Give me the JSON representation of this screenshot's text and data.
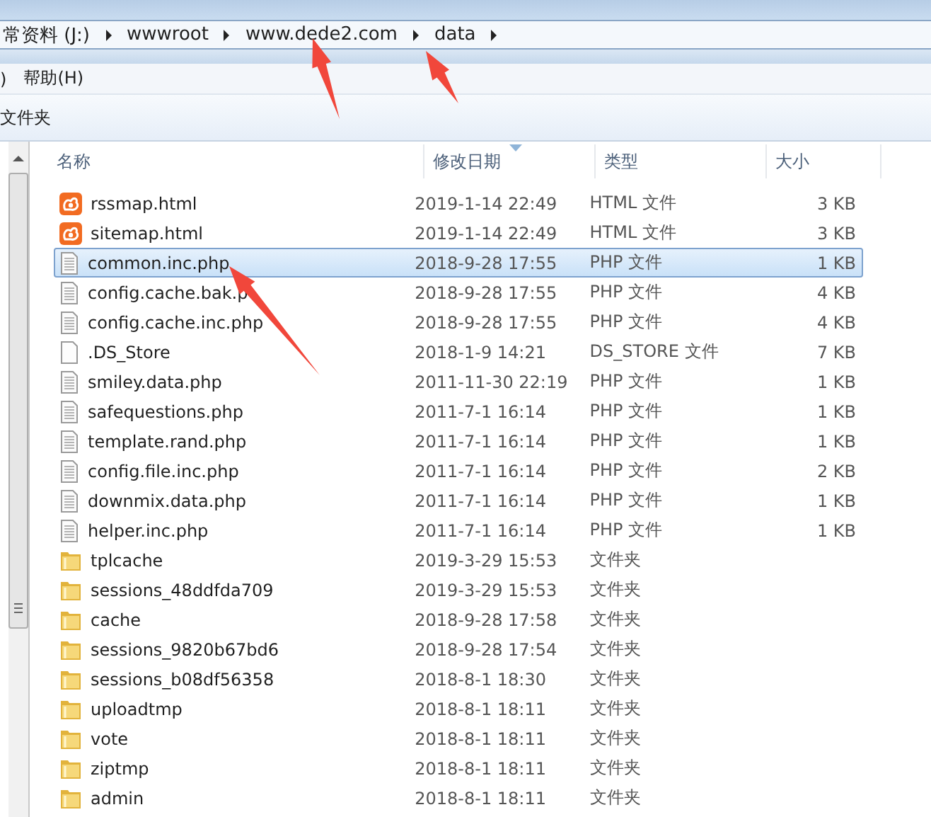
{
  "address_bar": {
    "crumbs": [
      "常资料 (J:)",
      "wwwroot",
      "www.dede2.com",
      "data"
    ]
  },
  "menu_bar": {
    "items": [
      ")",
      "帮助(H)"
    ]
  },
  "toolbar": {
    "items": [
      "文件夹"
    ]
  },
  "file_list": {
    "columns": [
      {
        "label": "名称",
        "sorted": false
      },
      {
        "label": "修改日期",
        "sorted": true
      },
      {
        "label": "类型",
        "sorted": false
      },
      {
        "label": "大小",
        "sorted": false
      }
    ],
    "rows": [
      {
        "name": "rssmap.html",
        "date": "2019-1-14 22:49",
        "type": "HTML 文件",
        "size": "3 KB",
        "kind": "html",
        "selected": false
      },
      {
        "name": "sitemap.html",
        "date": "2019-1-14 22:49",
        "type": "HTML 文件",
        "size": "3 KB",
        "kind": "html",
        "selected": false
      },
      {
        "name": "common.inc.php",
        "date": "2018-9-28 17:55",
        "type": "PHP 文件",
        "size": "1 KB",
        "kind": "text",
        "selected": true
      },
      {
        "name": "config.cache.bak.p",
        "date": "2018-9-28 17:55",
        "type": "PHP 文件",
        "size": "4 KB",
        "kind": "text",
        "selected": false
      },
      {
        "name": "config.cache.inc.php",
        "date": "2018-9-28 17:55",
        "type": "PHP 文件",
        "size": "4 KB",
        "kind": "text",
        "selected": false
      },
      {
        "name": ".DS_Store",
        "date": "2018-1-9 14:21",
        "type": "DS_STORE 文件",
        "size": "7 KB",
        "kind": "blank",
        "selected": false
      },
      {
        "name": "smiley.data.php",
        "date": "2011-11-30 22:19",
        "type": "PHP 文件",
        "size": "1 KB",
        "kind": "text",
        "selected": false
      },
      {
        "name": "safequestions.php",
        "date": "2011-7-1 16:14",
        "type": "PHP 文件",
        "size": "1 KB",
        "kind": "text",
        "selected": false
      },
      {
        "name": "template.rand.php",
        "date": "2011-7-1 16:14",
        "type": "PHP 文件",
        "size": "1 KB",
        "kind": "text",
        "selected": false
      },
      {
        "name": "config.file.inc.php",
        "date": "2011-7-1 16:14",
        "type": "PHP 文件",
        "size": "2 KB",
        "kind": "text",
        "selected": false
      },
      {
        "name": "downmix.data.php",
        "date": "2011-7-1 16:14",
        "type": "PHP 文件",
        "size": "1 KB",
        "kind": "text",
        "selected": false
      },
      {
        "name": "helper.inc.php",
        "date": "2011-7-1 16:14",
        "type": "PHP 文件",
        "size": "1 KB",
        "kind": "text",
        "selected": false
      },
      {
        "name": "tplcache",
        "date": "2019-3-29 15:53",
        "type": "文件夹",
        "kind": "folder",
        "selected": false
      },
      {
        "name": "sessions_48ddfda709",
        "date": "2019-3-29 15:53",
        "type": "文件夹",
        "kind": "folder",
        "selected": false
      },
      {
        "name": "cache",
        "date": "2018-9-28 17:58",
        "type": "文件夹",
        "kind": "folder",
        "selected": false
      },
      {
        "name": "sessions_9820b67bd6",
        "date": "2018-9-28 17:54",
        "type": "文件夹",
        "kind": "folder",
        "selected": false
      },
      {
        "name": "sessions_b08df56358",
        "date": "2018-8-1 18:30",
        "type": "文件夹",
        "kind": "folder",
        "selected": false
      },
      {
        "name": "uploadtmp",
        "date": "2018-8-1 18:11",
        "type": "文件夹",
        "kind": "folder",
        "selected": false
      },
      {
        "name": "vote",
        "date": "2018-8-1 18:11",
        "type": "文件夹",
        "kind": "folder",
        "selected": false
      },
      {
        "name": "ziptmp",
        "date": "2018-8-1 18:11",
        "type": "文件夹",
        "kind": "folder",
        "selected": false
      },
      {
        "name": "admin",
        "date": "2018-8-1 18:11",
        "type": "文件夹",
        "kind": "folder",
        "selected": false
      }
    ]
  }
}
